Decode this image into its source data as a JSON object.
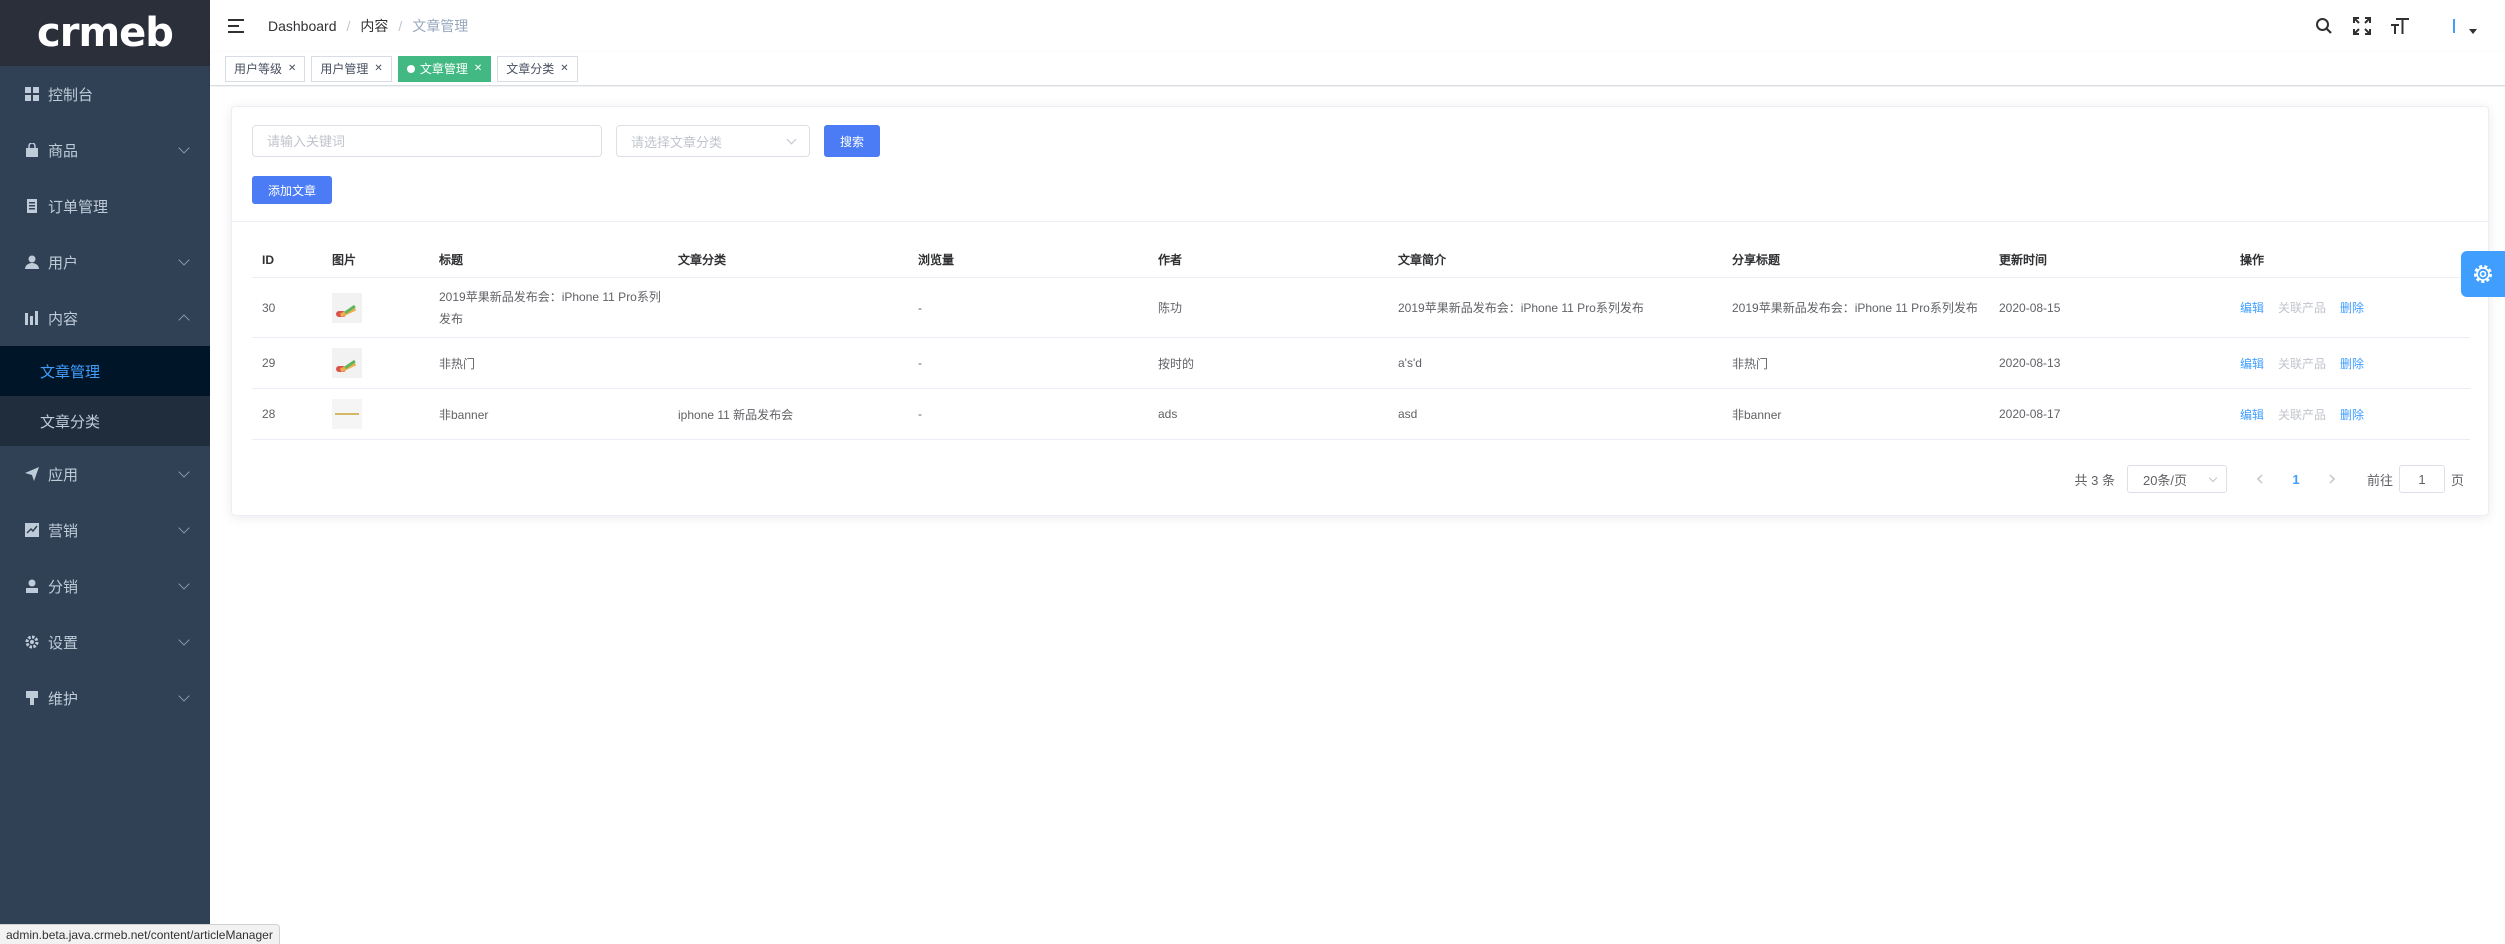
{
  "brand": {
    "logo_text": "crmeb"
  },
  "sidebar": {
    "items": [
      {
        "label": "控制台",
        "icon": "dashboard-icon",
        "has_children": false
      },
      {
        "label": "商品",
        "icon": "shop-bag-icon",
        "has_children": true
      },
      {
        "label": "订单管理",
        "icon": "order-icon",
        "has_children": false
      },
      {
        "label": "用户",
        "icon": "user-icon",
        "has_children": true
      },
      {
        "label": "内容",
        "icon": "chart-icon",
        "has_children": true,
        "expanded": true,
        "children": [
          {
            "label": "文章管理",
            "active": true
          },
          {
            "label": "文章分类",
            "active": false
          }
        ]
      },
      {
        "label": "应用",
        "icon": "send-icon",
        "has_children": true
      },
      {
        "label": "营销",
        "icon": "marketing-icon",
        "has_children": true
      },
      {
        "label": "分销",
        "icon": "distribution-icon",
        "has_children": true
      },
      {
        "label": "设置",
        "icon": "gear-icon",
        "has_children": true
      },
      {
        "label": "维护",
        "icon": "maintenance-icon",
        "has_children": true
      }
    ]
  },
  "header": {
    "breadcrumb": [
      "Dashboard",
      "内容",
      "文章管理"
    ],
    "icons": [
      "search-icon",
      "fullscreen-icon",
      "font-size-icon"
    ]
  },
  "tags": [
    {
      "label": "用户等级",
      "active": false
    },
    {
      "label": "用户管理",
      "active": false
    },
    {
      "label": "文章管理",
      "active": true
    },
    {
      "label": "文章分类",
      "active": false
    }
  ],
  "filters": {
    "keyword_placeholder": "请输入关键词",
    "category_placeholder": "请选择文章分类",
    "search_label": "搜索",
    "add_label": "添加文章"
  },
  "table": {
    "columns": [
      "ID",
      "图片",
      "标题",
      "文章分类",
      "浏览量",
      "作者",
      "文章简介",
      "分享标题",
      "更新时间",
      "操作"
    ],
    "rows": [
      {
        "id": "30",
        "title": "2019苹果新品发布会：iPhone 11 Pro系列发布",
        "category": "",
        "views": "-",
        "author": "陈功",
        "intro": "2019苹果新品发布会：iPhone 11 Pro系列发布",
        "share_title": "2019苹果新品发布会：iPhone 11 Pro系列发布",
        "updated": "2020-08-15"
      },
      {
        "id": "29",
        "title": "非热门",
        "category": "",
        "views": "-",
        "author": "按时的",
        "intro": "a's'd",
        "share_title": "非热门",
        "updated": "2020-08-13"
      },
      {
        "id": "28",
        "title": "非banner",
        "category": "iphone 11 新品发布会",
        "views": "-",
        "author": "ads",
        "intro": "asd",
        "share_title": "非banner",
        "updated": "2020-08-17"
      }
    ],
    "actions": {
      "edit": "编辑",
      "link_product": "关联产品",
      "delete": "删除"
    }
  },
  "pagination": {
    "total_text": "共 3 条",
    "page_size": "20条/页",
    "current_page": "1",
    "goto_prefix": "前往",
    "goto_value": "1",
    "goto_suffix": "页"
  },
  "statusbar": {
    "url": "admin.beta.java.crmeb.net/content/articleManager"
  },
  "colors": {
    "sidebar_bg": "#304156",
    "active_tag": "#42b983",
    "primary": "#409eff"
  }
}
